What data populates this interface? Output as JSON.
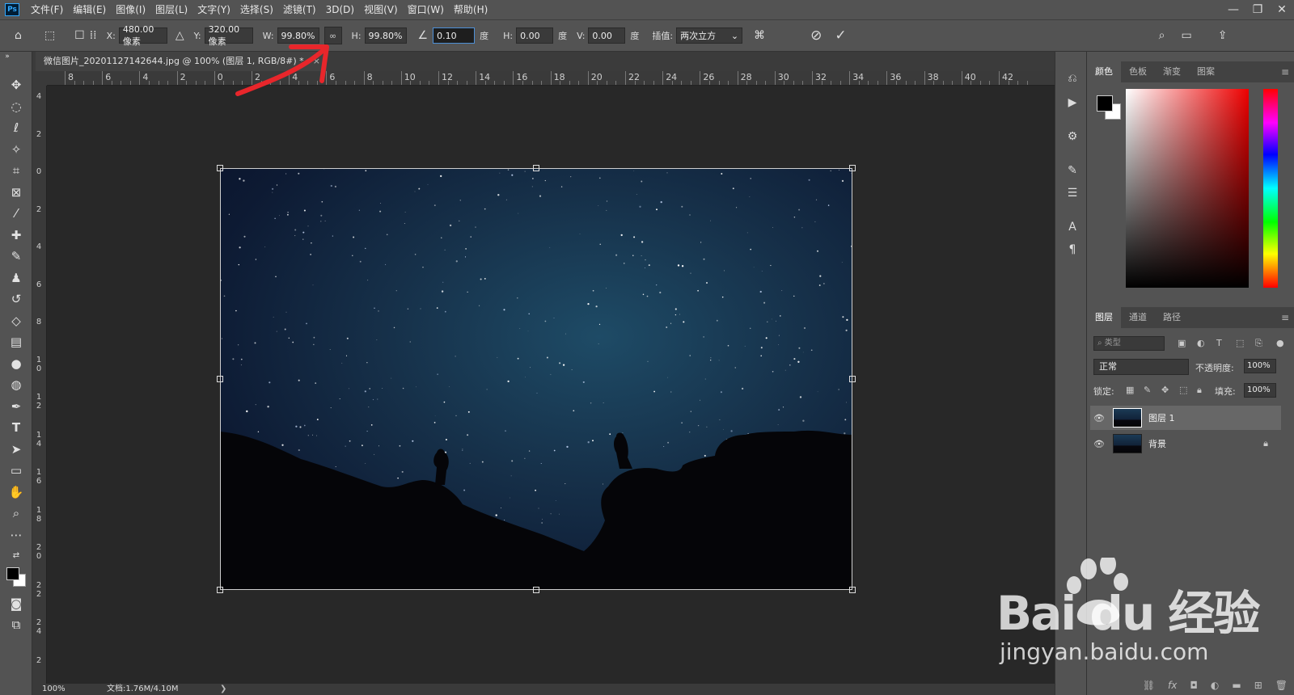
{
  "menu": {
    "logo": "Ps",
    "items": [
      "文件(F)",
      "编辑(E)",
      "图像(I)",
      "图层(L)",
      "文字(Y)",
      "选择(S)",
      "滤镜(T)",
      "3D(D)",
      "视图(V)",
      "窗口(W)",
      "帮助(H)"
    ]
  },
  "window_controls": {
    "minimize": "—",
    "restore": "❐",
    "close": "✕"
  },
  "options": {
    "x_label": "X:",
    "x_value": "480.00 像素",
    "y_label": "Y:",
    "y_value": "320.00 像素",
    "w_label": "W:",
    "w_value": "99.80%",
    "h_label": "H:",
    "h_value": "99.80%",
    "angle_value": "0.10",
    "angle_unit": "度",
    "hskew_label": "H:",
    "hskew_value": "0.00",
    "hskew_unit": "度",
    "vskew_label": "V:",
    "vskew_value": "0.00",
    "vskew_unit": "度",
    "interp_label": "插值:",
    "interp_value": "两次立方"
  },
  "document": {
    "tab_title": "微信图片_20201127142644.jpg @ 100% (图层 1, RGB/8#) *",
    "close": "×"
  },
  "ruler": {
    "h_labels": [
      "8",
      "6",
      "4",
      "2",
      "0",
      "2",
      "4",
      "6",
      "8",
      "10",
      "12",
      "14",
      "16",
      "18",
      "20",
      "22",
      "24",
      "26",
      "28",
      "30",
      "32",
      "34",
      "36",
      "38",
      "40",
      "42"
    ],
    "v_labels": [
      "4",
      "2",
      "0",
      "2",
      "4",
      "6",
      "8",
      "10",
      "12",
      "14",
      "16",
      "18",
      "20",
      "22",
      "24",
      "2"
    ]
  },
  "status": {
    "zoom": "100%",
    "doc_size": "文档:1.76M/4.10M",
    "arrow": "❯"
  },
  "color_panel": {
    "tabs": [
      "颜色",
      "色板",
      "渐变",
      "图案"
    ],
    "menu": "≡",
    "foreground": "#000000",
    "background": "#ffffff"
  },
  "layers_panel": {
    "tabs": [
      "图层",
      "通道",
      "路径"
    ],
    "menu": "≡",
    "filter_placeholder": "类型",
    "blend_mode": "正常",
    "opacity_label": "不透明度:",
    "opacity_value": "100%",
    "lock_label": "锁定:",
    "fill_label": "填充:",
    "fill_value": "100%",
    "layers": [
      {
        "name": "图层 1",
        "selected": true
      },
      {
        "name": "背景",
        "selected": false,
        "locked": true
      }
    ]
  },
  "watermark": {
    "text": "Bai du 经验",
    "url": "jingyan.baidu.com"
  },
  "colors": {
    "accent": "#4d8fd6",
    "annotation": "#e8262b"
  }
}
